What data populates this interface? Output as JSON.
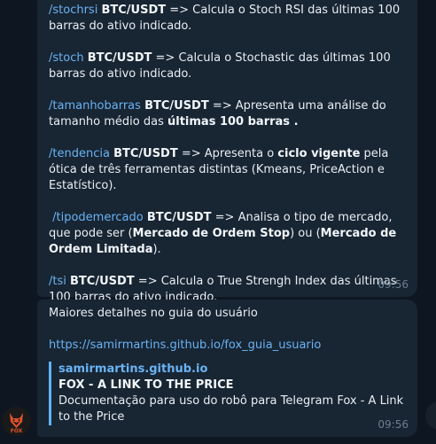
{
  "messages": [
    {
      "items": [
        {
          "cmd": "/stochrsi",
          "pair": "BTC/USDT",
          "pre": " => Calcula o Stoch RSI das últimas 100 barras do ativo indicado."
        },
        {
          "cmd": "/stoch",
          "pair": "BTC/USDT",
          "pre": " => Calcula o Stochastic das últimas 100 barras do ativo indicado."
        },
        {
          "cmd": "/tamanhobarras",
          "pair": "BTC/USDT",
          "pre": " => Apresenta uma análise do tamanho médio das ",
          "bold": "últimas 100 barras",
          "post": " ."
        },
        {
          "cmd": "/tendencia",
          "pair": "BTC/USDT",
          "pre": " => Apresenta o ",
          "bold": "ciclo vigente",
          "post": " pela ótica de três ferramentas distintas (Kmeans, PriceAction e Estatístico)."
        },
        {
          "cmd": "/tipodemercado",
          "pair": "BTC/USDT",
          "pre": " => Analisa o tipo de mercado, que pode ser (",
          "bold": "Mercado de Ordem Stop",
          "mid": ") ou (",
          "bold2": "Mercado de Ordem Limitada",
          "post": ")."
        },
        {
          "cmd": "/tsi",
          "pair": "BTC/USDT",
          "pre": " => Calcula o True Strengh Index das últimas 100 barras do ativo indicado."
        }
      ],
      "time": "09:56"
    },
    {
      "text": "Maiores detalhes no guia do usuário",
      "url": "https://samirmartins.github.io/fox_guia_usuario",
      "preview": {
        "site": "samirmartins.github.io",
        "title": "FOX - A LINK TO THE PRICE",
        "description": "Documentação para uso do robô para Telegram Fox - A Link to the Price"
      },
      "time": "09:56"
    }
  ],
  "avatar": {
    "label": "FOX",
    "icon": "fox-icon",
    "accent": "#e0522a"
  },
  "colors": {
    "background": "#0e1621",
    "bubble": "#182533",
    "link": "#6ab3f3",
    "time": "#6d7f8f"
  }
}
